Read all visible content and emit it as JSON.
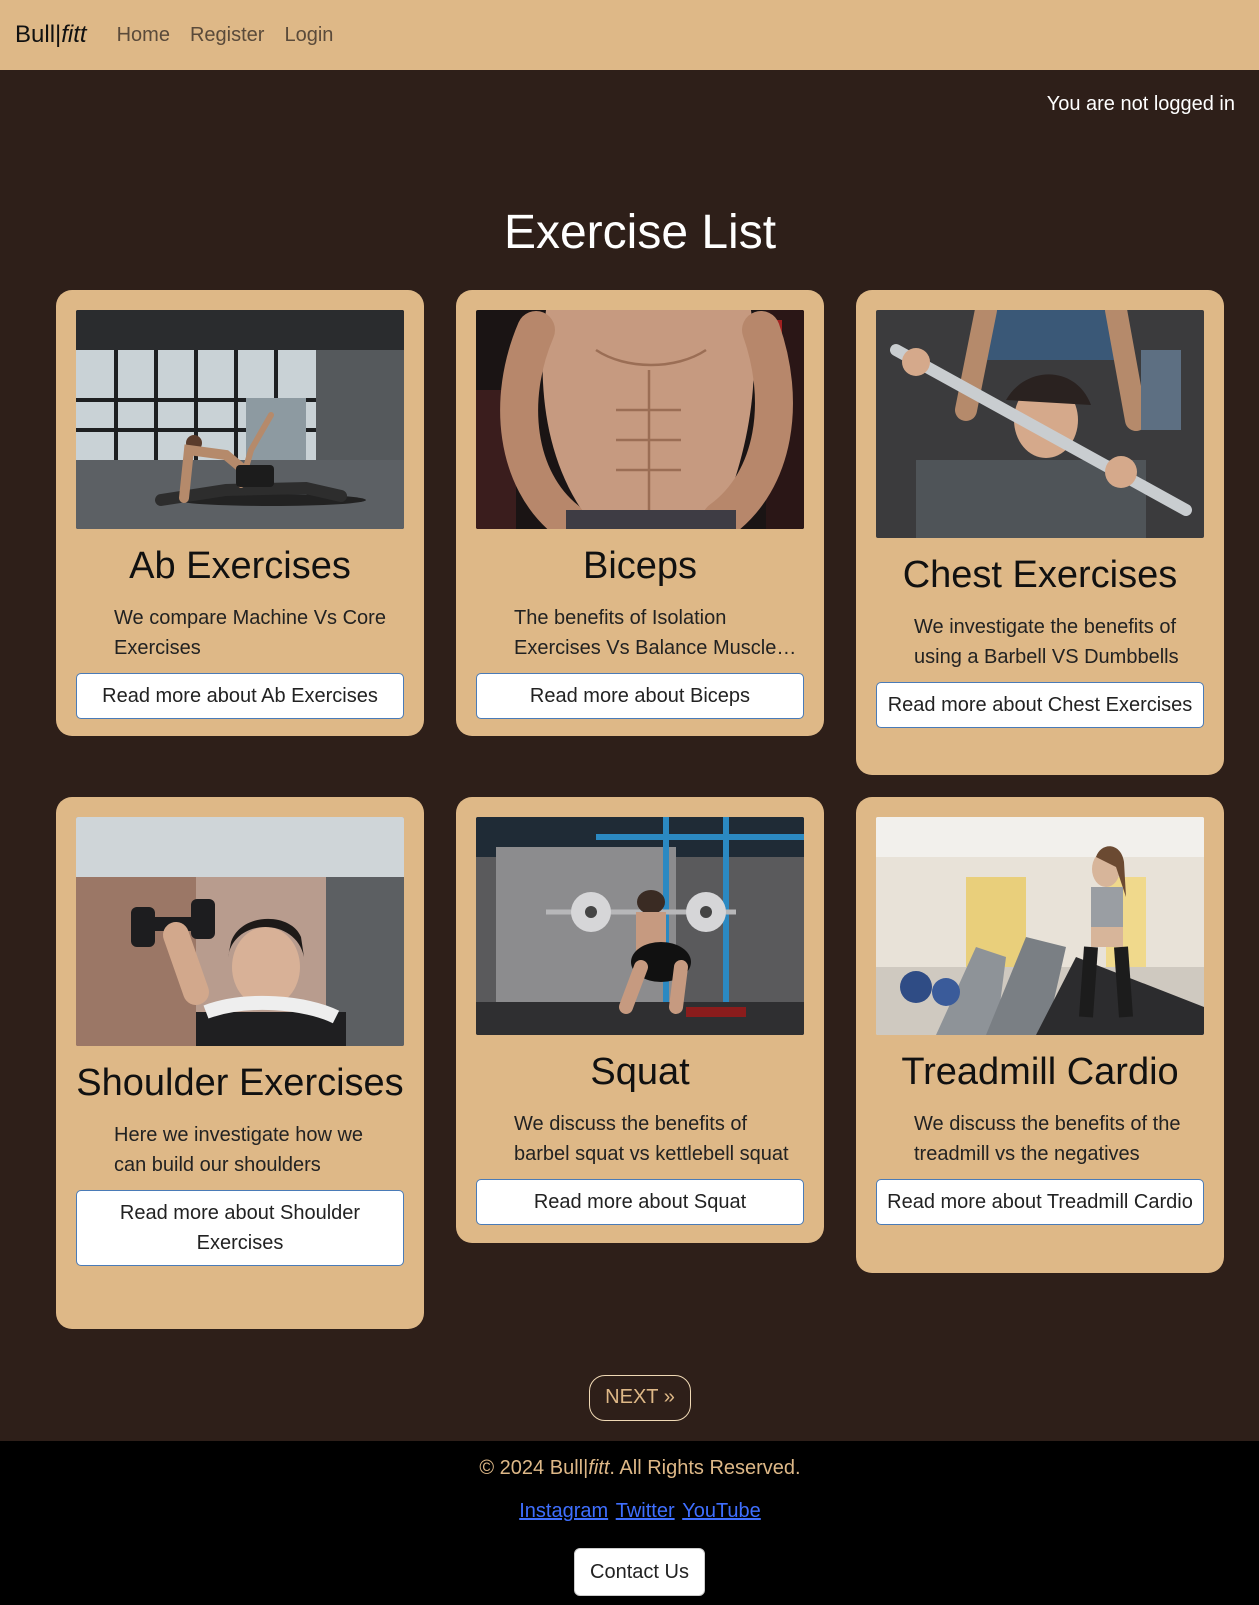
{
  "nav": {
    "brand_main": "Bull|",
    "brand_italic": "fitt",
    "links": [
      "Home",
      "Register",
      "Login"
    ]
  },
  "status": {
    "login_text": "You are not logged in"
  },
  "page": {
    "title": "Exercise List"
  },
  "cards": [
    {
      "title": "Ab Exercises",
      "text": "We compare Machine Vs Core Exercises",
      "button": "Read more about Ab Exercises",
      "image_icon": "side-plank-photo"
    },
    {
      "title": "Biceps",
      "text": "The benefits of Isolation Exercises Vs Balance Muscle Exercises",
      "button": "Read more about Biceps",
      "image_icon": "torso-muscles-photo"
    },
    {
      "title": "Chest Exercises",
      "text": "We investigate the benefits of using a Barbell VS Dumbbells",
      "button": "Read more about Chest Exercises",
      "image_icon": "bench-press-photo"
    },
    {
      "title": "Shoulder Exercises",
      "text": "Here we investigate how we can build our shoulders",
      "button": "Read more about Shoulder Exercises",
      "image_icon": "dumbbell-press-photo"
    },
    {
      "title": "Squat",
      "text": "We discuss the benefits of barbel squat vs kettlebell squat",
      "button": "Read more about Squat",
      "image_icon": "barbell-squat-photo"
    },
    {
      "title": "Treadmill Cardio",
      "text": "We discuss the benefits of the treadmill vs the negatives",
      "button": "Read more about Treadmill Cardio",
      "image_icon": "treadmill-photo"
    }
  ],
  "pagination": {
    "next": "NEXT »"
  },
  "footer": {
    "copyright_prefix": "© 2024 Bull|",
    "copyright_italic": "fitt",
    "copyright_suffix": ". All Rights Reserved.",
    "links": [
      "Instagram",
      "Twitter",
      "YouTube"
    ],
    "contact": "Contact Us"
  },
  "colors": {
    "background": "#2e1f19",
    "accent": "#deb887",
    "footer": "#000000",
    "link": "#3f6fff"
  }
}
